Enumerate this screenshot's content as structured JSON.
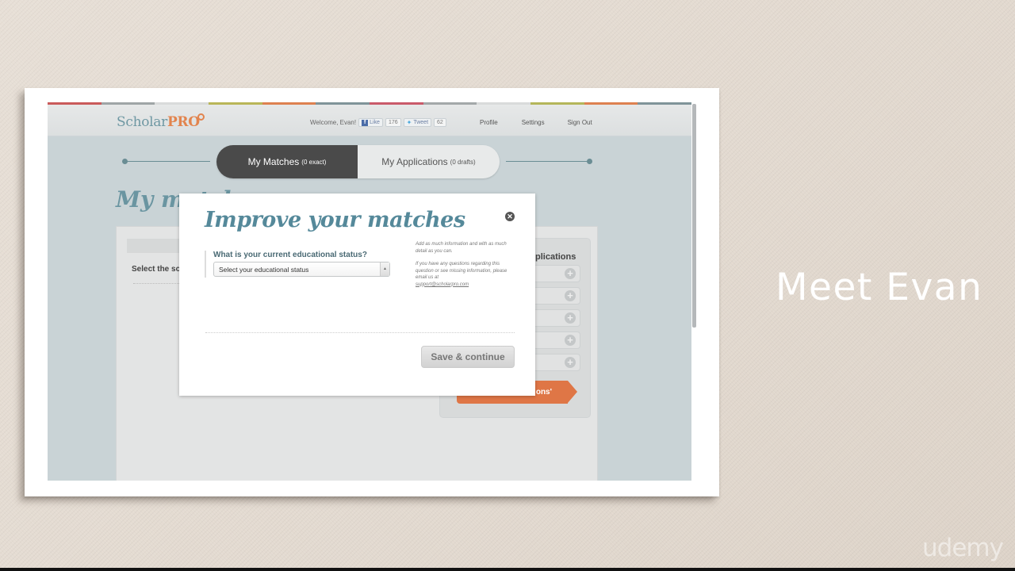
{
  "slide": {
    "title": "Meet Evan",
    "watermark": "udemy"
  },
  "site": {
    "color_strip": [
      "#c95a5a",
      "#9fa5a6",
      "#d9dbdb",
      "#b9b658",
      "#de8150",
      "#7f9499",
      "#c95a6a",
      "#a3a8a9",
      "#d9dbdb",
      "#b4b65a",
      "#de8150",
      "#7f9499"
    ],
    "logo": {
      "text": "Scholar",
      "accent": "PRO"
    },
    "header": {
      "welcome": "Welcome, Evan!",
      "like_label": "Like",
      "like_count": "176",
      "tweet_label": "Tweet",
      "tweet_count": "62",
      "nav": [
        "Profile",
        "Settings",
        "Sign Out"
      ]
    },
    "tabs": [
      {
        "label": "My Matches",
        "sub": "(0 exact)",
        "active": true
      },
      {
        "label": "My Applications",
        "sub": "(0 drafts)",
        "active": false
      }
    ],
    "page_title": "My matches",
    "main": {
      "select_label": "Select the sc"
    },
    "right_panel": {
      "title": "plications",
      "rows": 5,
      "arrow_button": "ons'"
    }
  },
  "modal": {
    "title": "Improve your matches",
    "question": "What is your current educational status?",
    "select_placeholder": "Select your educational status",
    "help_1": "Add as much information and with as much detail as you can.",
    "help_2": "If you have any questions regarding this question or see missing information, please email us at",
    "help_email": "support@scholarpro.com",
    "save_button": "Save & continue"
  }
}
